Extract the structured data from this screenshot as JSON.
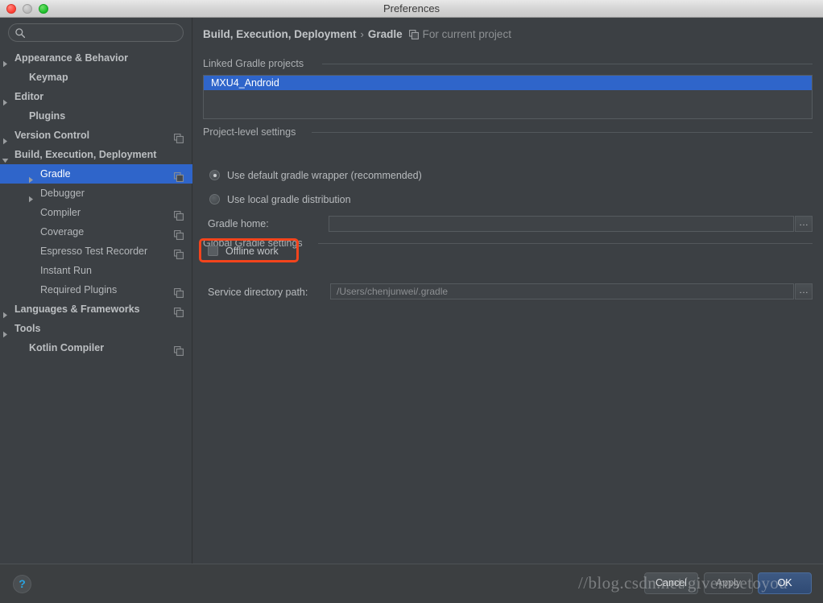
{
  "window": {
    "title": "Preferences",
    "traffic_lights": [
      "close",
      "minimize",
      "zoom"
    ]
  },
  "sidebar": {
    "search": {
      "value": "",
      "placeholder": ""
    },
    "items": [
      {
        "label": "Appearance & Behavior",
        "indent": 14,
        "arrow": "right",
        "bold": true,
        "badge": false,
        "selected": false
      },
      {
        "label": "Keymap",
        "indent": 32,
        "arrow": "none",
        "bold": true,
        "badge": false,
        "selected": false
      },
      {
        "label": "Editor",
        "indent": 14,
        "arrow": "right",
        "bold": true,
        "badge": false,
        "selected": false
      },
      {
        "label": "Plugins",
        "indent": 32,
        "arrow": "none",
        "bold": true,
        "badge": false,
        "selected": false
      },
      {
        "label": "Version Control",
        "indent": 14,
        "arrow": "right",
        "bold": true,
        "badge": true,
        "selected": false
      },
      {
        "label": "Build, Execution, Deployment",
        "indent": 14,
        "arrow": "down",
        "bold": true,
        "badge": false,
        "selected": false
      },
      {
        "label": "Gradle",
        "indent": 46,
        "arrow": "right",
        "bold": false,
        "badge": true,
        "selected": true
      },
      {
        "label": "Debugger",
        "indent": 46,
        "arrow": "right",
        "bold": false,
        "badge": false,
        "selected": false
      },
      {
        "label": "Compiler",
        "indent": 46,
        "arrow": "none",
        "bold": false,
        "badge": true,
        "selected": false
      },
      {
        "label": "Coverage",
        "indent": 46,
        "arrow": "none",
        "bold": false,
        "badge": true,
        "selected": false
      },
      {
        "label": "Espresso Test Recorder",
        "indent": 46,
        "arrow": "none",
        "bold": false,
        "badge": true,
        "selected": false
      },
      {
        "label": "Instant Run",
        "indent": 46,
        "arrow": "none",
        "bold": false,
        "badge": false,
        "selected": false
      },
      {
        "label": "Required Plugins",
        "indent": 46,
        "arrow": "none",
        "bold": false,
        "badge": true,
        "selected": false
      },
      {
        "label": "Languages & Frameworks",
        "indent": 14,
        "arrow": "right",
        "bold": true,
        "badge": true,
        "selected": false
      },
      {
        "label": "Tools",
        "indent": 14,
        "arrow": "right",
        "bold": true,
        "badge": false,
        "selected": false
      },
      {
        "label": "Kotlin Compiler",
        "indent": 32,
        "arrow": "none",
        "bold": true,
        "badge": true,
        "selected": false
      }
    ]
  },
  "breadcrumb": {
    "group": "Build, Execution, Deployment",
    "separator": "›",
    "page": "Gradle",
    "scope_icon": "project-scope-icon",
    "scope": "For current project"
  },
  "main": {
    "linked_projects": {
      "caption": "Linked Gradle projects",
      "items": [
        {
          "label": "MXU4_Android",
          "selected": true
        }
      ]
    },
    "project_level": {
      "caption": "Project-level settings",
      "radios": [
        {
          "label": "Use default gradle wrapper (recommended)",
          "selected": true
        },
        {
          "label": "Use local gradle distribution",
          "selected": false
        }
      ],
      "gradle_home": {
        "label": "Gradle home:",
        "value": "",
        "placeholder": "",
        "browse_label": "…"
      }
    },
    "global_settings": {
      "caption": "Global Gradle settings",
      "offline_work": {
        "label": "Offline work",
        "checked": false,
        "highlighted": true
      },
      "service_directory": {
        "label": "Service directory path:",
        "value": "/Users/chenjunwei/.gradle",
        "browse_label": "…"
      }
    }
  },
  "footer": {
    "help_label": "?",
    "buttons": [
      {
        "name": "cancel",
        "label": "Cancel"
      },
      {
        "name": "apply",
        "label": "Apply"
      },
      {
        "name": "ok",
        "label": "OK"
      }
    ],
    "watermark": "//blog.csdn.net/giverosetoyou"
  },
  "colors": {
    "accent_selection": "#2f65ca",
    "highlight_box": "#f4441c",
    "window_bg": "#3c3f41",
    "panel_bg": "#3c4044",
    "help_blue": "#2aa3e0"
  }
}
